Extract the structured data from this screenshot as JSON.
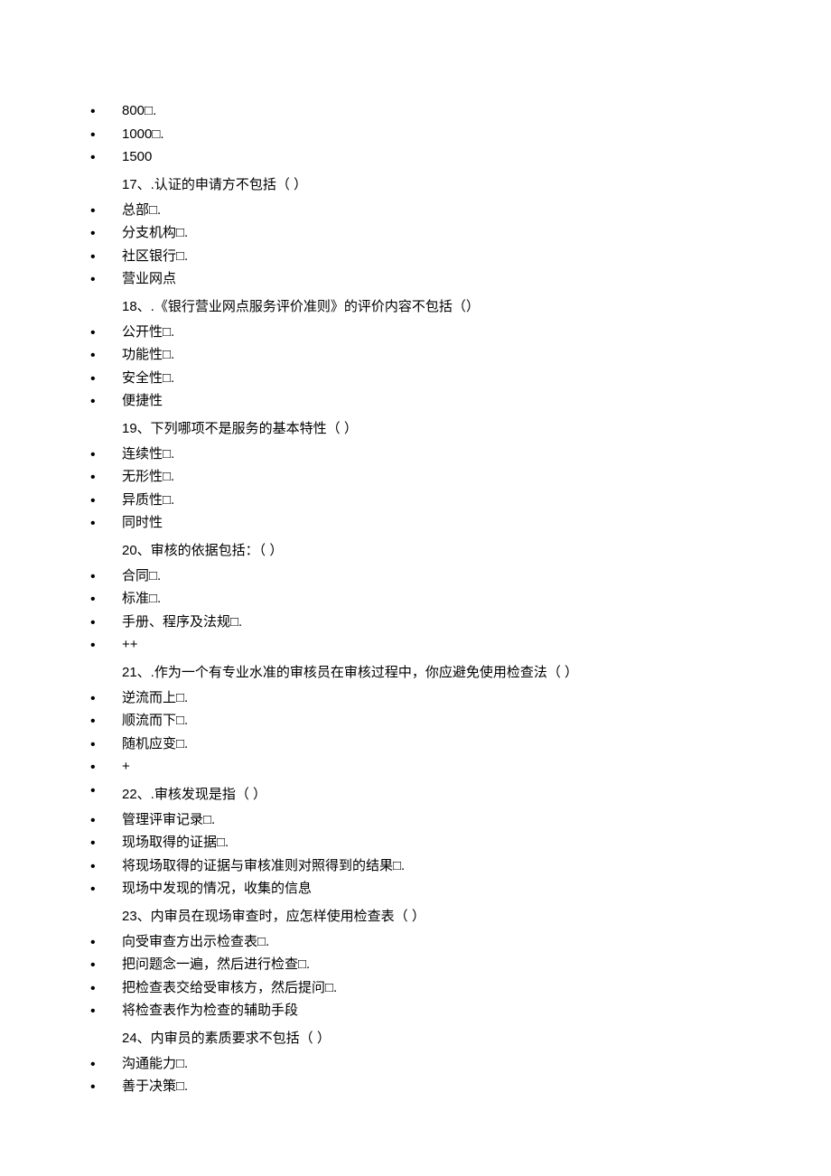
{
  "items": [
    {
      "type": "option",
      "text": "800□."
    },
    {
      "type": "option",
      "text": "1000□."
    },
    {
      "type": "option",
      "text": "1500"
    },
    {
      "type": "question",
      "text": "17、.认证的申请方不包括（ ）"
    },
    {
      "type": "option",
      "text": "总部□."
    },
    {
      "type": "option",
      "text": "分支机构□."
    },
    {
      "type": "option",
      "text": "社区银行□."
    },
    {
      "type": "option",
      "text": "营业网点"
    },
    {
      "type": "question",
      "text": "18、.《银行营业网点服务评价准则》的评价内容不包括（）"
    },
    {
      "type": "option",
      "text": "公开性□."
    },
    {
      "type": "option",
      "text": "功能性□."
    },
    {
      "type": "option",
      "text": "安全性□."
    },
    {
      "type": "option",
      "text": "便捷性"
    },
    {
      "type": "question",
      "text": "19、下列哪项不是服务的基本特性（ ）"
    },
    {
      "type": "option",
      "text": "连续性□."
    },
    {
      "type": "option",
      "text": "无形性□."
    },
    {
      "type": "option",
      "text": "异质性□."
    },
    {
      "type": "option",
      "text": "同时性"
    },
    {
      "type": "question",
      "text": "20、审核的依据包括：（ ）"
    },
    {
      "type": "option",
      "text": "合同□."
    },
    {
      "type": "option",
      "text": "标准□."
    },
    {
      "type": "option",
      "text": "手册、程序及法规□."
    },
    {
      "type": "option",
      "text": "++"
    },
    {
      "type": "question",
      "text": "21、.作为一个有专业水准的审核员在审核过程中，你应避免使用检查法（ ）"
    },
    {
      "type": "option",
      "text": "逆流而上□."
    },
    {
      "type": "option",
      "text": "顺流而下□."
    },
    {
      "type": "option",
      "text": "随机应变□."
    },
    {
      "type": "option",
      "text": "+"
    },
    {
      "type": "option",
      "text": ""
    },
    {
      "type": "question",
      "text": "22、.审核发现是指（ ）"
    },
    {
      "type": "option",
      "text": "管理评审记录□."
    },
    {
      "type": "option",
      "text": "现场取得的证据□."
    },
    {
      "type": "option",
      "text": "将现场取得的证据与审核准则对照得到的结果□."
    },
    {
      "type": "option",
      "text": "现场中发现的情况，收集的信息"
    },
    {
      "type": "question",
      "text": "23、内审员在现场审查时，应怎样使用检查表（ ）"
    },
    {
      "type": "option",
      "text": "向受审查方出示检查表□."
    },
    {
      "type": "option",
      "text": "把问题念一遍，然后进行检查□."
    },
    {
      "type": "option",
      "text": "把检查表交给受审核方，然后提问□."
    },
    {
      "type": "option",
      "text": "将检查表作为检查的辅助手段"
    },
    {
      "type": "question",
      "text": "24、内审员的素质要求不包括（ ）"
    },
    {
      "type": "option",
      "text": "沟通能力□."
    },
    {
      "type": "option",
      "text": "善于决策□."
    }
  ]
}
